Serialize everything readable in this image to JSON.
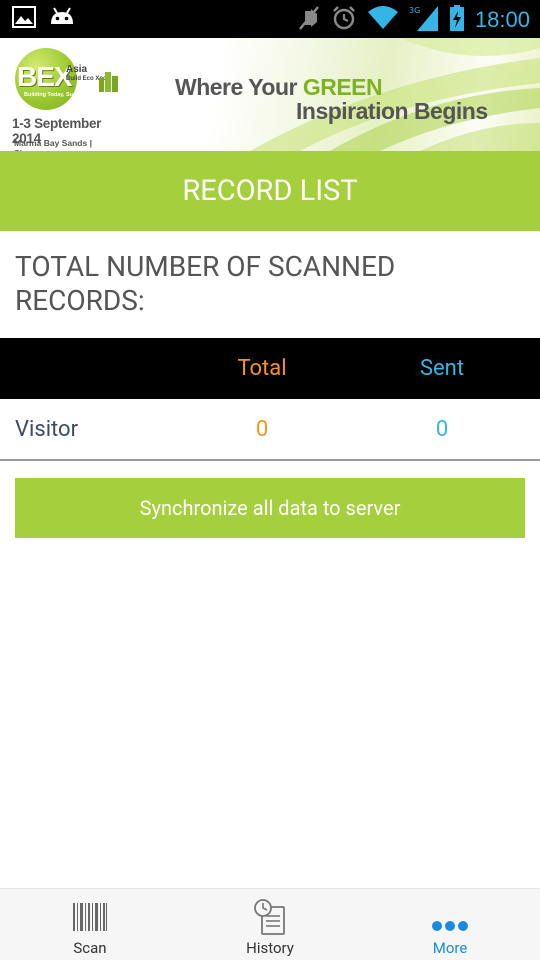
{
  "status_bar": {
    "time": "18:00",
    "network_label": "3G",
    "icons": [
      "image-icon",
      "android-icon",
      "mute-icon",
      "alarm-icon",
      "wifi-icon",
      "signal-icon",
      "battery-charging-icon"
    ]
  },
  "banner": {
    "logo_text": "BEX",
    "logo_subtext": "Asia",
    "logo_expo": "Build Eco Xpo",
    "logo_tagline": "Building Today, Sustaining Tomorrow",
    "event_dates": "1-3 September 2014",
    "venue": "Marina Bay Sands | Singapore",
    "tagline_line1_prefix": "Where Your ",
    "tagline_line1_highlight": "GREEN",
    "tagline_line2": "Inspiration Begins"
  },
  "header": {
    "title": "RECORD LIST"
  },
  "summary": {
    "label": "TOTAL NUMBER OF SCANNED RECORDS:"
  },
  "table": {
    "columns": [
      "",
      "Total",
      "Sent"
    ],
    "rows": [
      {
        "name": "Visitor",
        "total": "0",
        "sent": "0"
      }
    ]
  },
  "actions": {
    "sync_label": "Synchronize all data to server"
  },
  "bottom_nav": {
    "items": [
      {
        "label": "Scan",
        "icon": "barcode-icon",
        "active": false
      },
      {
        "label": "History",
        "icon": "history-icon",
        "active": false
      },
      {
        "label": "More",
        "icon": "more-dots-icon",
        "active": true
      }
    ]
  },
  "colors": {
    "accent_green": "#a5cf3d",
    "total_orange": "#f7931e",
    "sent_blue": "#33b5e5",
    "nav_active_blue": "#1a8ae0"
  }
}
